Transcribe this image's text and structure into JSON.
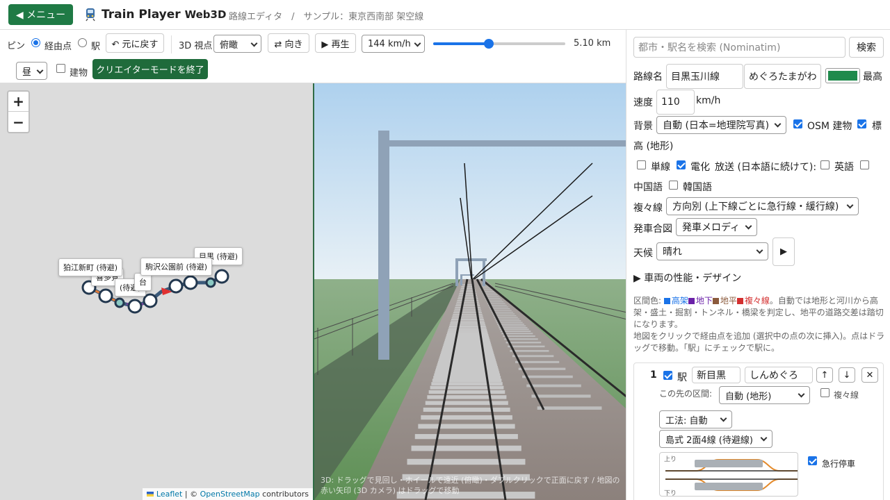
{
  "header": {
    "menu_label": "◀ メニュー",
    "title_main": "Train Player",
    "title_suffix": "Web3D",
    "breadcrumb": "路線エディタ　/　サンプル：東京西南部 架空線"
  },
  "toolbar": {
    "pin_label": "ピン",
    "waypoint_label": "経由点",
    "station_label": "駅",
    "undo_label": "↶ 元に戻す",
    "view_label": "3D 視点",
    "view_value": "俯瞰",
    "direction_label": "⇄ 向き",
    "play_label": "▶ 再生",
    "speed_value": "144 km/h",
    "slider_fraction": 0.42,
    "distance": "5.10 km",
    "time_value": "昼",
    "buildings_label": "建物",
    "creator_exit_label": "クリエイターモードを終了"
  },
  "map": {
    "zoom_in": "+",
    "zoom_out": "−",
    "labels": [
      "狛江新町 (待避)",
      "駒沢公園前 (待避)",
      "目黒 (待避)",
      "喜多見",
      "台",
      "(待避)"
    ],
    "attribution_leaflet": "Leaflet",
    "attribution_sep": " | © ",
    "attribution_osm": "OpenStreetMap",
    "attribution_tail": " contributors"
  },
  "view3d": {
    "hint": "3D: ドラッグで見回し・ホイールで遠近 (俯瞰)・ダブルクリックで正面に戻す / 地図の赤い矢印 (3D カメラ) はドラッグで移動"
  },
  "panel": {
    "search_placeholder": "都市・駅名を検索 (Nominatim)",
    "search_button": "検索",
    "line_name_label": "路線名",
    "line_name": "目黒玉川線",
    "line_kana": "めぐろたまがわ",
    "line_color": "#1f8a4c",
    "max_label": "最高",
    "speed_label": "速度",
    "speed_value": "110",
    "speed_unit": "km/h",
    "bg_label": "背景",
    "bg_value": "自動 (日本=地理院写真)",
    "osm_label": "OSM 建物",
    "elev_label_a": "標",
    "elev_label_b": "高 (地形)",
    "single_label": "単線",
    "electric_label": "電化",
    "announce_label": "放送 (日本語に続けて):",
    "english_label": "英語",
    "chinese_label": "中国語",
    "korean_label": "韓国語",
    "multi_label": "複々線",
    "multi_value": "方向別 (上下線ごとに急行線・緩行線)",
    "departure_label": "発車合図",
    "departure_value": "発車メロディ",
    "weather_label": "天候",
    "weather_value": "晴れ",
    "play_icon": "▶",
    "perf_label": "▶ 車両の性能・デザイン",
    "help_prefix": "区間色: ",
    "help_elev": "高架",
    "help_under": "地下",
    "help_ground": "地平",
    "help_multi": "複々線",
    "help_rest": "。自動では地形と河川から高架・盛土・掘割・トンネル・橋梁を判定し、地平の道路交差は踏切になります。",
    "help_line2": "地図をクリックで経由点を追加 (選択中の点の次に挿入)。点はドラッグで移動。「駅」にチェックで駅に。",
    "colors": {
      "elev": "#1a73e8",
      "under": "#6b21a8",
      "ground": "#8b5a3c",
      "multi": "#d32f2f"
    },
    "card": {
      "index": "1",
      "station_label": "駅",
      "station_name": "新目黒",
      "station_kana": "しんめぐろ",
      "up": "↑",
      "down": "↓",
      "close": "✕",
      "next_label": "この先の区間:",
      "next_value": "自動 (地形)",
      "multi_label": "複々線",
      "method_value": "工法: 自動",
      "platform_value": "島式 2面4線 (待避線)",
      "express_label": "急行停車",
      "diagram_up": "上り",
      "diagram_down": "下り"
    }
  }
}
